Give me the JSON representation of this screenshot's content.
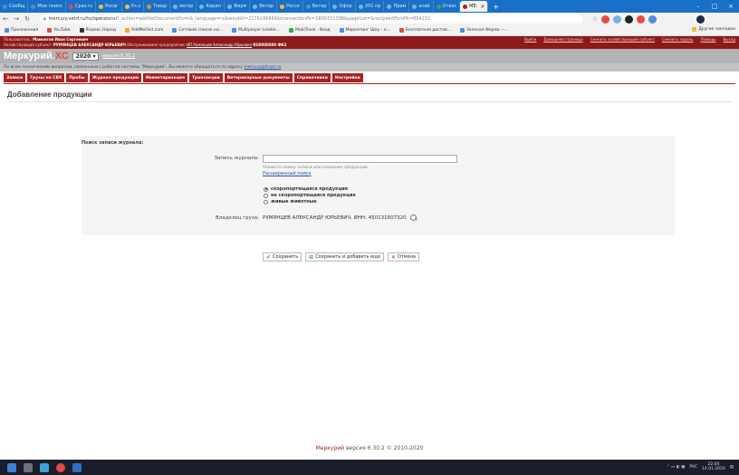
{
  "browser": {
    "tabs": [
      {
        "label": "Сообщ",
        "color": "#4d8fe0"
      },
      {
        "label": "Мои поиск",
        "color": "#4d8fe0"
      },
      {
        "label": "Cpas.ru",
        "color": "#e04b4b"
      },
      {
        "label": "Росаг",
        "color": "#e8c43a"
      },
      {
        "label": "Уч.э",
        "color": "#e8c43a"
      },
      {
        "label": "Товар",
        "color": "#e0902a"
      },
      {
        "label": "ветер",
        "color": "#7ab1ea"
      },
      {
        "label": "Кирил",
        "color": "#7ab1ea"
      },
      {
        "label": "Фирм",
        "color": "#7ab1ea"
      },
      {
        "label": "Ветер",
        "color": "#7ab1ea"
      },
      {
        "label": "Россе",
        "color": "#e8c43a"
      },
      {
        "label": "Ветер",
        "color": "#4d8fe0"
      },
      {
        "label": "Офор",
        "color": "#7ab1ea"
      },
      {
        "label": "201 пр",
        "color": "#7ab1ea"
      },
      {
        "label": "Прим",
        "color": "#7ab1ea"
      },
      {
        "label": "асай",
        "color": "#7ab1ea"
      },
      {
        "label": "Отвес",
        "color": "#3aa35a"
      }
    ],
    "active_tab": {
      "label": "МЕ:",
      "close": "×"
    },
    "newtab": "+",
    "window_controls": {
      "minimize": "–",
      "maximize": "□",
      "close": "×"
    },
    "url_host": "mercury.vetrf.ru/hs/operatorui",
    "url_rest": "?_action=addVetDocumentForm&_language=ru&waybill=2176186666&transactionPk=1800331398&pageList=&recipientFirmPk=864232",
    "bookmarks": [
      {
        "label": "Приложения",
        "color": "#4d8fe0"
      },
      {
        "label": "YouTube",
        "color": "#e04b4b"
      },
      {
        "label": "Яндекс.Народ",
        "color": "#333333"
      },
      {
        "label": "AddMeFast.com",
        "color": "#f0a43a"
      },
      {
        "label": "Сетевой список ки...",
        "color": "#4d8fe0"
      },
      {
        "label": "Multiplayer Leader...",
        "color": "#4d8fe0"
      },
      {
        "label": "MobiTrack - Вход",
        "color": "#3aa35a"
      },
      {
        "label": "Маркетинг Шоу - н...",
        "color": "#4d8fe0"
      },
      {
        "label": "Бесплатная достав...",
        "color": "#e04b4b"
      },
      {
        "label": "Зеленая Ферма —...",
        "color": "#4d8fe0"
      }
    ],
    "bookmarks_other": "Другие закладки"
  },
  "app": {
    "user_prefix": "Пользователь:",
    "user_name": "Мамонтов Иван Сергеевич",
    "top_links": [
      "Выйти",
      "Домашняя страница",
      "Сменить хозяйствующий субъект",
      "Сменить пароль",
      "Помощь",
      "Выход"
    ],
    "biz_prefix": "Хозяйствующий субъект:",
    "biz_name": "РУМЯНЦЕВ АЛЕКСАНДР ЮРЬЕВИЧ",
    "biz_mid": "Обслуживаемое предприятие:",
    "biz_place": "ИП Румянцев Александр Юрьевич",
    "biz_code": "RU0000000 ФК2",
    "brand_main": "Меркурий.",
    "brand_xc": "ХС",
    "year": "2020 ▾",
    "version": "версия 6.30.2",
    "info_text": "По всем техническим вопросам, связанным с работой системы \"Меркурий\", Вы можете обращаться по адресу",
    "info_email": "mercury@fsvps.ru",
    "menu": [
      "Заявки",
      "Грузы на СВХ",
      "Пробы",
      "Журнал продукции",
      "Инвентаризация",
      "Транзакции",
      "Ветеринарные документы",
      "Справочники",
      "Настройки"
    ]
  },
  "page": {
    "title": "Добавление продукции",
    "search_header": "Поиск записи журнала:",
    "journal_label": "Запись журнала:",
    "journal_value": "",
    "journal_hint": "Укажите номер записи или название продукции",
    "advanced_search": "Расширенный поиск",
    "radios": [
      {
        "label": "скоропортящаяся продукция",
        "checked": true
      },
      {
        "label": "не скоропортящаяся продукция",
        "checked": false
      },
      {
        "label": "живые животные",
        "checked": false
      }
    ],
    "owner_label": "Владелец груза:",
    "owner_value": "РУМЯНЦЕВ АЛЕКСАНДР ЮРЬЕВИЧ, ИНН: 450131607320",
    "buttons": {
      "save": "Сохранить",
      "save_add": "Сохранить и добавить еще",
      "cancel": "Отмена"
    }
  },
  "footer": {
    "brand": "Меркурий",
    "text": "версия 6.30.2 © 2010-2020"
  },
  "taskbar": {
    "clock_time": "22:04",
    "clock_date": "14.01.2020",
    "lang": "РУС"
  }
}
